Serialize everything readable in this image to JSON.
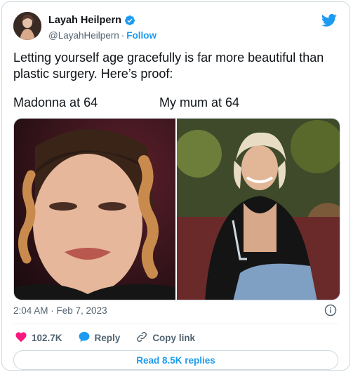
{
  "author": {
    "name": "Layah Heilpern",
    "handle": "@LayahHeilpern",
    "separator": "·",
    "follow_label": "Follow"
  },
  "tweet": {
    "text": "Letting yourself age gracefully is far more beautiful than plastic surgery. Here’s proof:",
    "caption_left": "Madonna at 64",
    "caption_right": "My mum at 64",
    "timestamp": "2:04 AM · Feb 7, 2023"
  },
  "actions": {
    "likes": "102.7K",
    "reply_label": "Reply",
    "copy_label": "Copy link",
    "read_replies": "Read 8.5K replies"
  },
  "icons": {
    "verified": "verified-badge-icon",
    "platform": "twitter-bird-icon",
    "info": "info-icon",
    "like": "heart-icon",
    "reply": "reply-bubble-icon",
    "copy": "link-icon"
  },
  "colors": {
    "accent": "#1d9bf0",
    "like": "#f91880",
    "text": "#0f1419",
    "secondary": "#536471"
  }
}
